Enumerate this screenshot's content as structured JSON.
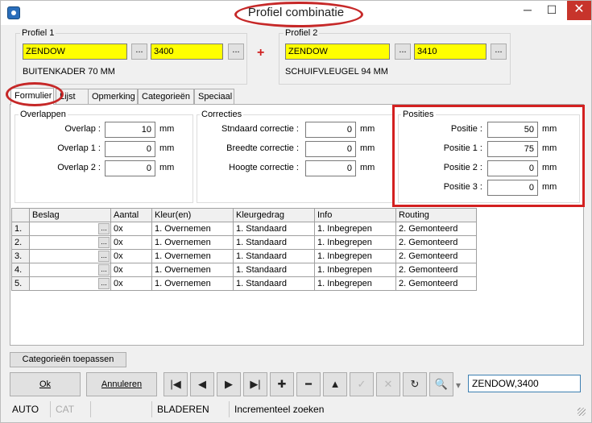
{
  "window": {
    "title": "Profiel combinatie",
    "controls": {
      "minimize": "─",
      "maximize": "☐",
      "close": "✕"
    }
  },
  "profiel1": {
    "label": "Profiel 1",
    "name": "ZENDOW",
    "code": "3400",
    "description": "BUITENKADER 70 MM",
    "dots": "..."
  },
  "profiel2": {
    "label": "Profiel 2",
    "name": "ZENDOW",
    "code": "3410",
    "description": "SCHUIFVLEUGEL 94 MM",
    "dots": "..."
  },
  "plus": "+",
  "tabs": [
    "Formulier",
    "Lijst",
    "Opmerking",
    "Categorieën",
    "Speciaal"
  ],
  "overlappen": {
    "title": "Overlappen",
    "unit": "mm",
    "fields": [
      {
        "label": "Overlap :",
        "value": "10"
      },
      {
        "label": "Overlap 1 :",
        "value": "0"
      },
      {
        "label": "Overlap 2 :",
        "value": "0"
      }
    ]
  },
  "correcties": {
    "title": "Correcties",
    "unit": "mm",
    "fields": [
      {
        "label": "Stndaard correctie :",
        "value": "0"
      },
      {
        "label": "Breedte correctie :",
        "value": "0"
      },
      {
        "label": "Hoogte correctie :",
        "value": "0"
      }
    ]
  },
  "posities": {
    "title": "Posities",
    "unit": "mm",
    "fields": [
      {
        "label": "Positie :",
        "value": "50"
      },
      {
        "label": "Positie 1 :",
        "value": "75"
      },
      {
        "label": "Positie 2 :",
        "value": "0"
      },
      {
        "label": "Positie 3 :",
        "value": "0"
      }
    ]
  },
  "grid": {
    "columns": [
      "",
      "Beslag",
      "Aantal",
      "Kleur(en)",
      "Kleurgedrag",
      "Info",
      "Routing"
    ],
    "rows": [
      {
        "num": "1.",
        "aantal": "0x",
        "kleur": "1. Overnemen",
        "gedrag": "1. Standaard",
        "info": "1. Inbegrepen",
        "routing": "2. Gemonteerd"
      },
      {
        "num": "2.",
        "aantal": "0x",
        "kleur": "1. Overnemen",
        "gedrag": "1. Standaard",
        "info": "1. Inbegrepen",
        "routing": "2. Gemonteerd"
      },
      {
        "num": "3.",
        "aantal": "0x",
        "kleur": "1. Overnemen",
        "gedrag": "1. Standaard",
        "info": "1. Inbegrepen",
        "routing": "2. Gemonteerd"
      },
      {
        "num": "4.",
        "aantal": "0x",
        "kleur": "1. Overnemen",
        "gedrag": "1. Standaard",
        "info": "1. Inbegrepen",
        "routing": "2. Gemonteerd"
      },
      {
        "num": "5.",
        "aantal": "0x",
        "kleur": "1. Overnemen",
        "gedrag": "1. Standaard",
        "info": "1. Inbegrepen",
        "routing": "2. Gemonteerd"
      }
    ],
    "cell_button": "..."
  },
  "buttons": {
    "categorieen": "Categorieën toepassen",
    "ok": "Ok",
    "annuleren": "Annuleren"
  },
  "toolbar": {
    "first": "|◀",
    "prev": "◀",
    "next": "▶",
    "last": "▶|",
    "add": "✚",
    "remove": "━",
    "up": "▲",
    "confirm": "✓",
    "cancel": "✕",
    "refresh": "↻",
    "search": "🔍",
    "dropdown": "▾"
  },
  "search_value": "ZENDOW,3400",
  "status": {
    "auto": "AUTO",
    "cat": "CAT",
    "mode": "BLADEREN",
    "search_mode": "Incrementeel zoeken"
  },
  "colors": {
    "highlight": "#ffff00",
    "annotation_red": "#c62828"
  }
}
